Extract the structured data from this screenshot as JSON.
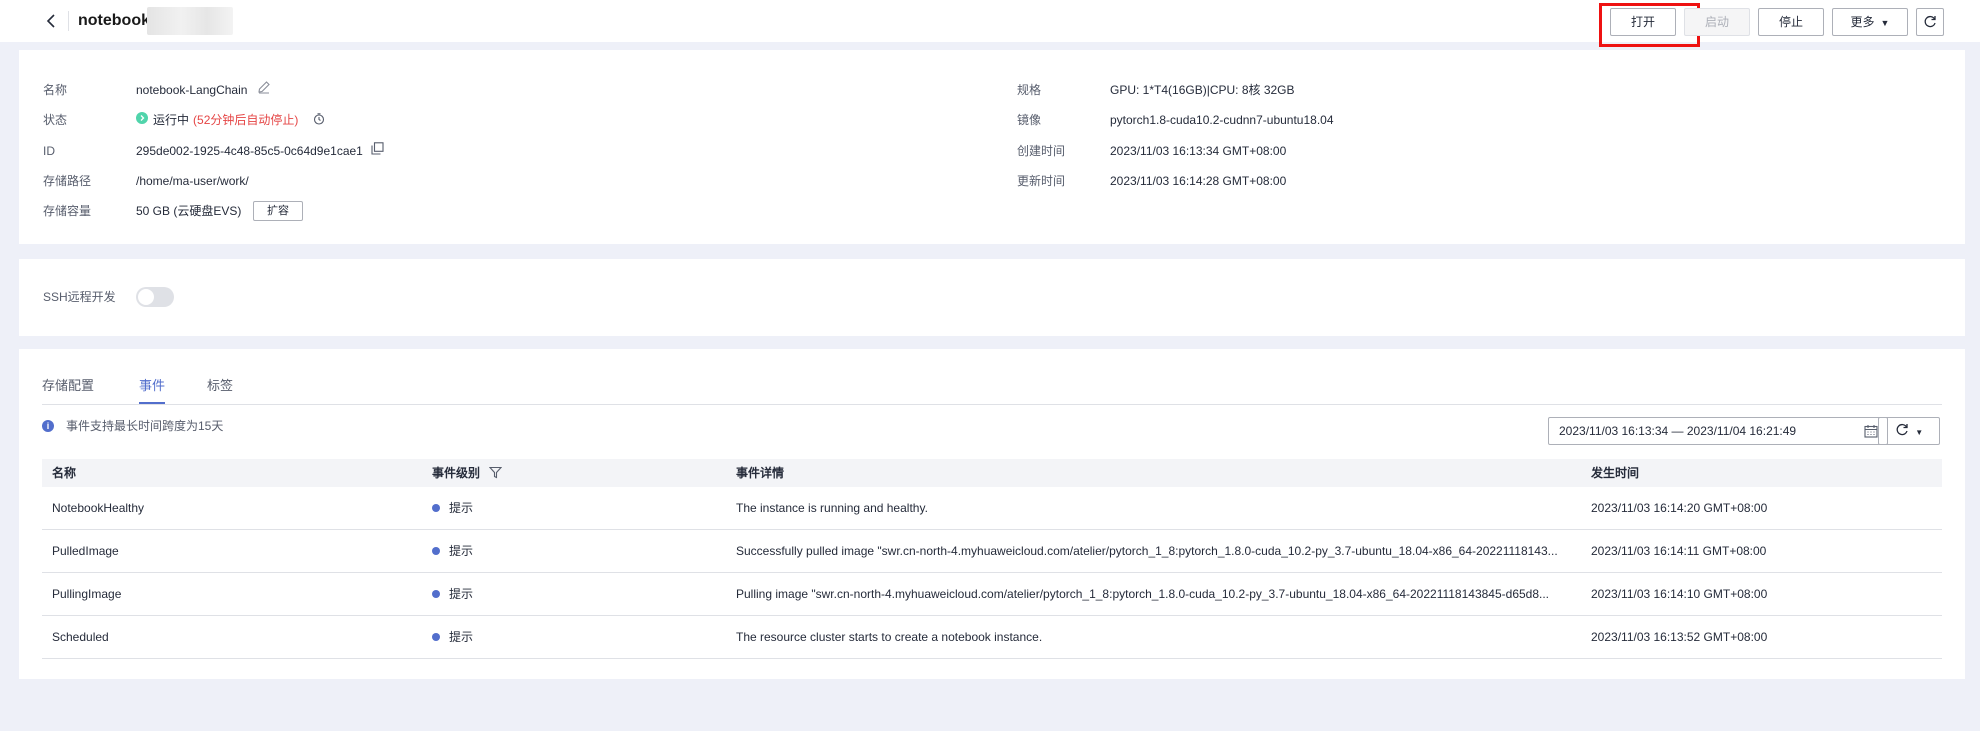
{
  "header": {
    "title": "notebook",
    "buttons": {
      "open": "打开",
      "start": "启动",
      "stop": "停止",
      "more": "更多"
    }
  },
  "details": {
    "name_label": "名称",
    "name_value": "notebook-LangChain",
    "status_label": "状态",
    "status_value": "运行中",
    "status_note_open": "(",
    "status_note": "52分钟后自动停止",
    "status_note_close": ")",
    "id_label": "ID",
    "id_value": "295de002-1925-4c48-85c5-0c64d9e1cae1",
    "path_label": "存储路径",
    "path_value": "/home/ma-user/work/",
    "capacity_label": "存储容量",
    "capacity_value": "50 GB (云硬盘EVS)",
    "expand_button": "扩容",
    "spec_label": "规格",
    "spec_value": "GPU: 1*T4(16GB)|CPU: 8核 32GB",
    "image_label": "镜像",
    "image_value": "pytorch1.8-cuda10.2-cudnn7-ubuntu18.04",
    "created_label": "创建时间",
    "created_value": "2023/11/03 16:13:34 GMT+08:00",
    "updated_label": "更新时间",
    "updated_value": "2023/11/03 16:14:28 GMT+08:00"
  },
  "ssh": {
    "label": "SSH远程开发",
    "enabled": false
  },
  "tabs": [
    {
      "label": "存储配置",
      "active": false
    },
    {
      "label": "事件",
      "active": true
    },
    {
      "label": "标签",
      "active": false
    }
  ],
  "events": {
    "notice": "事件支持最长时间跨度为15天",
    "date_range": "2023/11/03 16:13:34 — 2023/11/04 16:21:49",
    "columns": {
      "name": "名称",
      "level": "事件级别",
      "detail": "事件详情",
      "time": "发生时间"
    },
    "rows": [
      {
        "name": "NotebookHealthy",
        "level": "提示",
        "detail": "The instance is running and healthy.",
        "time": "2023/11/03 16:14:20 GMT+08:00"
      },
      {
        "name": "PulledImage",
        "level": "提示",
        "detail": "Successfully pulled image \"swr.cn-north-4.myhuaweicloud.com/atelier/pytorch_1_8:pytorch_1.8.0-cuda_10.2-py_3.7-ubuntu_18.04-x86_64-20221118143...",
        "time": "2023/11/03 16:14:11 GMT+08:00"
      },
      {
        "name": "PullingImage",
        "level": "提示",
        "detail": "Pulling image \"swr.cn-north-4.myhuaweicloud.com/atelier/pytorch_1_8:pytorch_1.8.0-cuda_10.2-py_3.7-ubuntu_18.04-x86_64-20221118143845-d65d8...",
        "time": "2023/11/03 16:14:10 GMT+08:00"
      },
      {
        "name": "Scheduled",
        "level": "提示",
        "detail": "The resource cluster starts to create a notebook instance.",
        "time": "2023/11/03 16:13:52 GMT+08:00"
      }
    ]
  },
  "colors": {
    "accent": "#526ecc",
    "warning_text": "#e54545",
    "running": "#50d4ab",
    "highlight_box": "#ee1111"
  },
  "icons": [
    "back-icon",
    "edit-icon",
    "running-status-icon",
    "timer-icon",
    "copy-icon",
    "calendar-icon",
    "refresh-icon",
    "filter-icon",
    "info-icon",
    "chevron-down-icon"
  ]
}
